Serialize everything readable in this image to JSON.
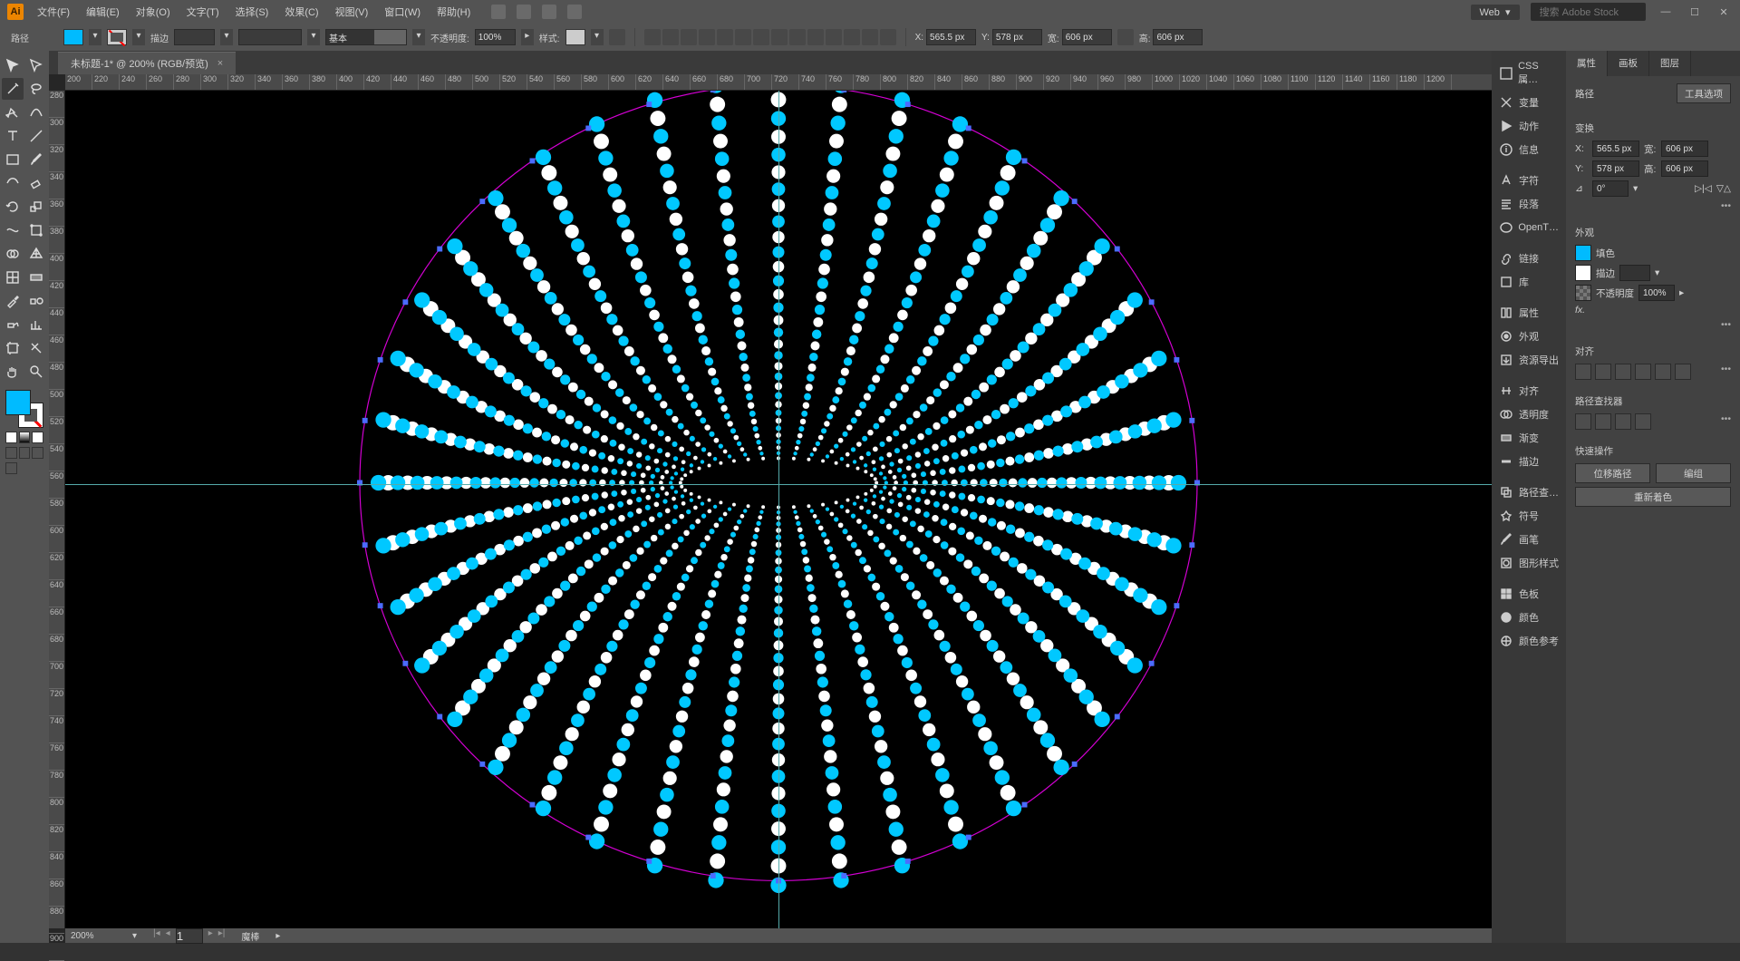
{
  "app": {
    "logo": "Ai",
    "workspace": "Web",
    "search_ph": "搜索 Adobe Stock"
  },
  "menu": {
    "file": "文件(F)",
    "edit": "编辑(E)",
    "object": "对象(O)",
    "type": "文字(T)",
    "select": "选择(S)",
    "effect": "效果(C)",
    "view": "视图(V)",
    "window": "窗口(W)",
    "help": "帮助(H)"
  },
  "opt": {
    "sel_label": "路径",
    "stroke_lbl": "描边",
    "stroke_val": "",
    "stroke_px": "",
    "profile": "基本",
    "opacity_lbl": "不透明度:",
    "opacity": "100%",
    "style_lbl": "样式:",
    "x_lbl": "X:",
    "x": "565.5 px",
    "y_lbl": "Y:",
    "y": "578 px",
    "w_lbl": "宽:",
    "w": "606 px",
    "h_lbl": "高:",
    "h": "606 px"
  },
  "tab": {
    "title": "未标题-1* @ 200% (RGB/预览)"
  },
  "status": {
    "zoom": "200%",
    "tool": "魔棒"
  },
  "midpanel": {
    "css": "CSS 属…",
    "vars": "变量",
    "actions": "动作",
    "info": "信息",
    "char": "字符",
    "para": "段落",
    "opentype": "OpenT…",
    "links": "链接",
    "lib": "库",
    "props": "属性",
    "appear": "外观",
    "assets": "资源导出",
    "align": "对齐",
    "transp": "透明度",
    "grad": "渐变",
    "stroke": "描边",
    "pathf": "路径查…",
    "symbols": "符号",
    "brushes": "画笔",
    "graphic": "图形样式",
    "swatches": "色板",
    "color": "颜色",
    "colorguide": "颜色参考"
  },
  "rpanel": {
    "tabs": {
      "props": "属性",
      "libs": "画板",
      "layers": "图层"
    },
    "path": "路径",
    "tool_opts": "工具选项",
    "transform": "变换",
    "appear": "外观",
    "fill": "填色",
    "stroke": "描边",
    "opacity": "不透明度",
    "opacity_val": "100%",
    "fx": "fx.",
    "x": "565.5 px",
    "y": "578 px",
    "w": "606 px",
    "h": "606 px",
    "angle": "0°",
    "align": "对齐",
    "pathfinder": "路径查找器",
    "quick": "快速操作",
    "offset": "位移路径",
    "group": "编组",
    "recolor": "重新着色"
  },
  "ruler_h": [
    "200",
    "220",
    "240",
    "260",
    "280",
    "300",
    "320",
    "340",
    "360",
    "380",
    "400",
    "420",
    "440",
    "460",
    "480",
    "500",
    "520",
    "540",
    "560",
    "580",
    "600",
    "620",
    "640",
    "660",
    "680",
    "700",
    "720",
    "740",
    "760",
    "780",
    "800",
    "820",
    "840",
    "860",
    "880",
    "900",
    "920",
    "940",
    "960",
    "980",
    "1000",
    "1020",
    "1040",
    "1060",
    "1080",
    "1100",
    "1120",
    "1140",
    "1160",
    "1180",
    "1200"
  ],
  "ruler_v": [
    "280",
    "300",
    "320",
    "340",
    "360",
    "380",
    "400",
    "420",
    "440",
    "460",
    "480",
    "500",
    "520",
    "540",
    "560",
    "580",
    "600",
    "620",
    "640",
    "660",
    "680",
    "700",
    "720",
    "740",
    "760",
    "780",
    "800",
    "820",
    "840",
    "860",
    "880",
    "900"
  ]
}
